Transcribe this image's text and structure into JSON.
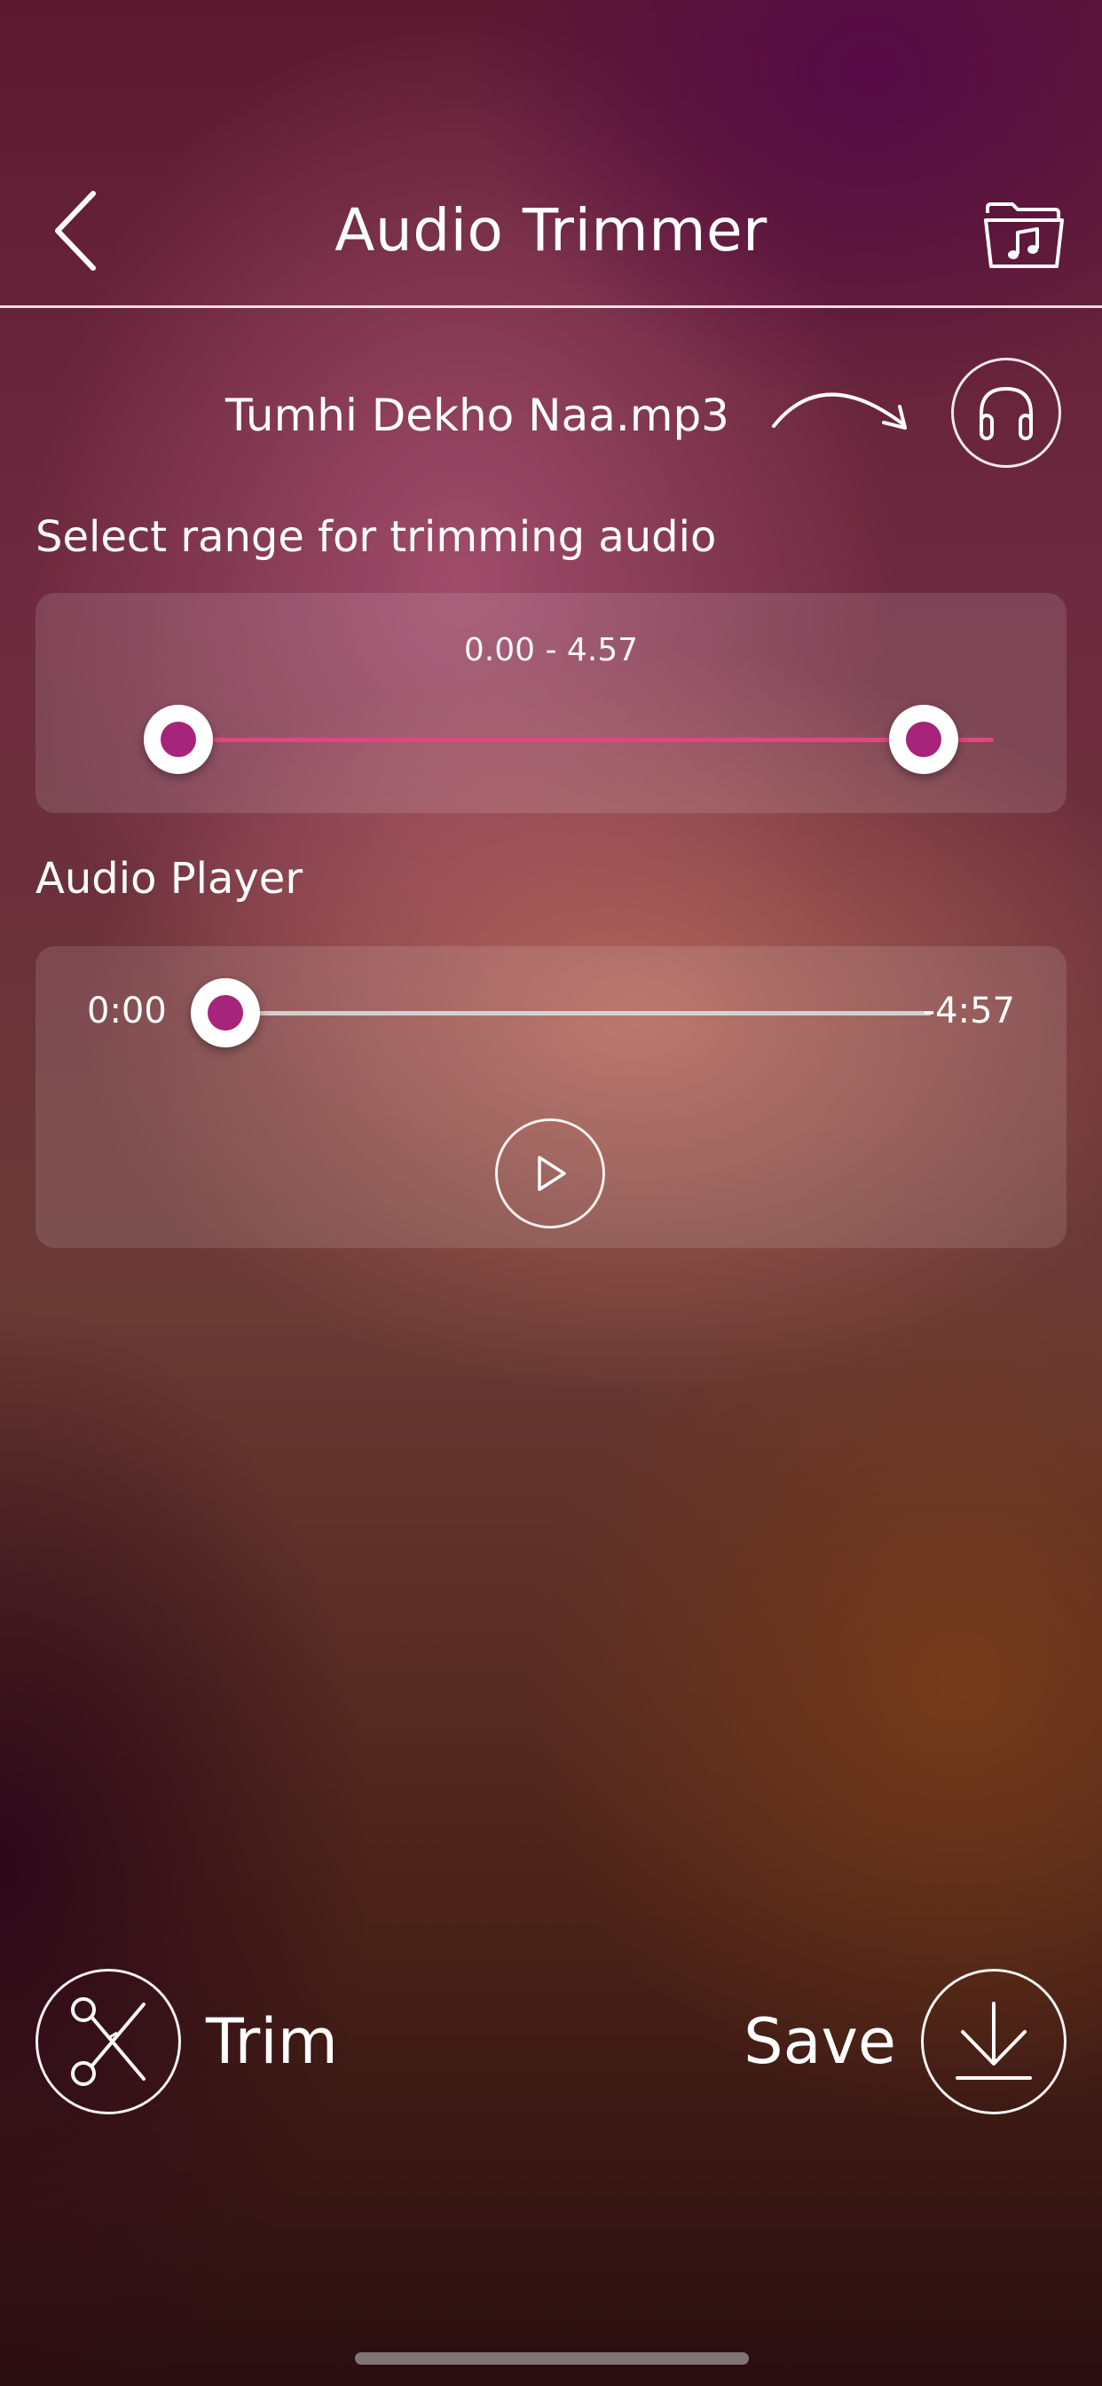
{
  "header": {
    "title": "Audio Trimmer",
    "back_icon": "chevron-left-icon",
    "folder_icon": "music-folder-icon"
  },
  "file": {
    "name": "Tumhi Dekho Naa.mp3",
    "arrow_icon": "curved-arrow-icon",
    "listen_icon": "headphones-icon"
  },
  "range": {
    "label": "Select range for trimming audio",
    "value_text": "0.00 - 4.57",
    "start_fraction": 0.0,
    "end_fraction": 1.0
  },
  "player": {
    "label": "Audio Player",
    "current_time": "0:00",
    "remaining_time": "-4:57",
    "progress_fraction": 0.0,
    "play_icon": "play-icon"
  },
  "actions": {
    "trim_label": "Trim",
    "trim_icon": "scissors-icon",
    "save_label": "Save",
    "save_icon": "download-icon"
  },
  "colors": {
    "accent": "#a6247a",
    "range_track": "#e0467f",
    "text": "#ffffff"
  }
}
